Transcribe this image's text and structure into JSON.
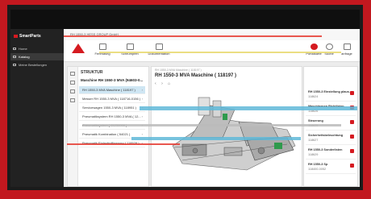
{
  "app": {
    "brand": "SmartParts",
    "company": "RH 1550-3 HESS GROUP GmbH"
  },
  "sidebar": {
    "items": [
      {
        "label": "Home",
        "icon": "home-icon"
      },
      {
        "label": "Katalog",
        "icon": "catalog-icon"
      },
      {
        "label": "Meine Bestellungen",
        "icon": "cart-icon"
      }
    ]
  },
  "toolbar": {
    "items": [
      {
        "label": "Fertmasng",
        "icon": "factory-icon"
      },
      {
        "label": "Schrumpfen",
        "icon": "shrink-icon"
      },
      {
        "label": "Dokumentation",
        "icon": "document-icon"
      }
    ],
    "right": [
      {
        "label": "Portalkarte",
        "icon": "portal-icon"
      },
      {
        "label": "Suche",
        "icon": "search-icon"
      },
      {
        "label": "anfrage",
        "icon": "inquiry-icon"
      }
    ]
  },
  "structure": {
    "title": "STRUKTUR",
    "root": "Maschine RH 1550-3 MVA (94603-0...",
    "items": [
      {
        "label": "RH 1550-3 MVA Maschine ( 118197 )",
        "selected": true
      },
      {
        "label": "Messer RH 1550-3 MVA ( 118716-0156 )",
        "selected": false
      },
      {
        "label": "Servicewagen 1550-3 MVA ( 118951 )",
        "selected": false
      },
      {
        "label": "Pneumatiksystem RH 1550-3 MVA ( 12...",
        "selected": false
      },
      {
        "label": "Pneumatiksystem ( 05230066 )",
        "selected": false
      },
      {
        "label": "Pneumatik Kombination ( 54021 )",
        "selected": false
      },
      {
        "label": "Pneumatik Einlaufmillinerung ( 118529 )",
        "selected": false
      }
    ]
  },
  "viewer": {
    "breadcrumb": "RH 1550-3 MVA Maschine ( 118197 )",
    "title": "RH 1550-3 MVA Maschine ( 118197 )",
    "tools": [
      "‹",
      "›",
      "⌂"
    ]
  },
  "details": {
    "cards": [
      {
        "title": "RH 1550-3 Einstellung plaus..",
        "sub": "118624"
      },
      {
        "title": "Maschinenen Richtlinien",
        "sub": "118626"
      },
      {
        "title": "Steuerung",
        "sub": "118625"
      },
      {
        "title": "Sicherheitsbeleuchtung",
        "sub": "118627"
      },
      {
        "title": "RH 1550-3 Sonderlisten",
        "sub": "118629"
      },
      {
        "title": "RH 1550-3 Sp",
        "sub": "118400-0052"
      }
    ]
  },
  "colors": {
    "accent": "#d51a20",
    "background": "#c2181f",
    "selection": "#cfe6f3"
  }
}
